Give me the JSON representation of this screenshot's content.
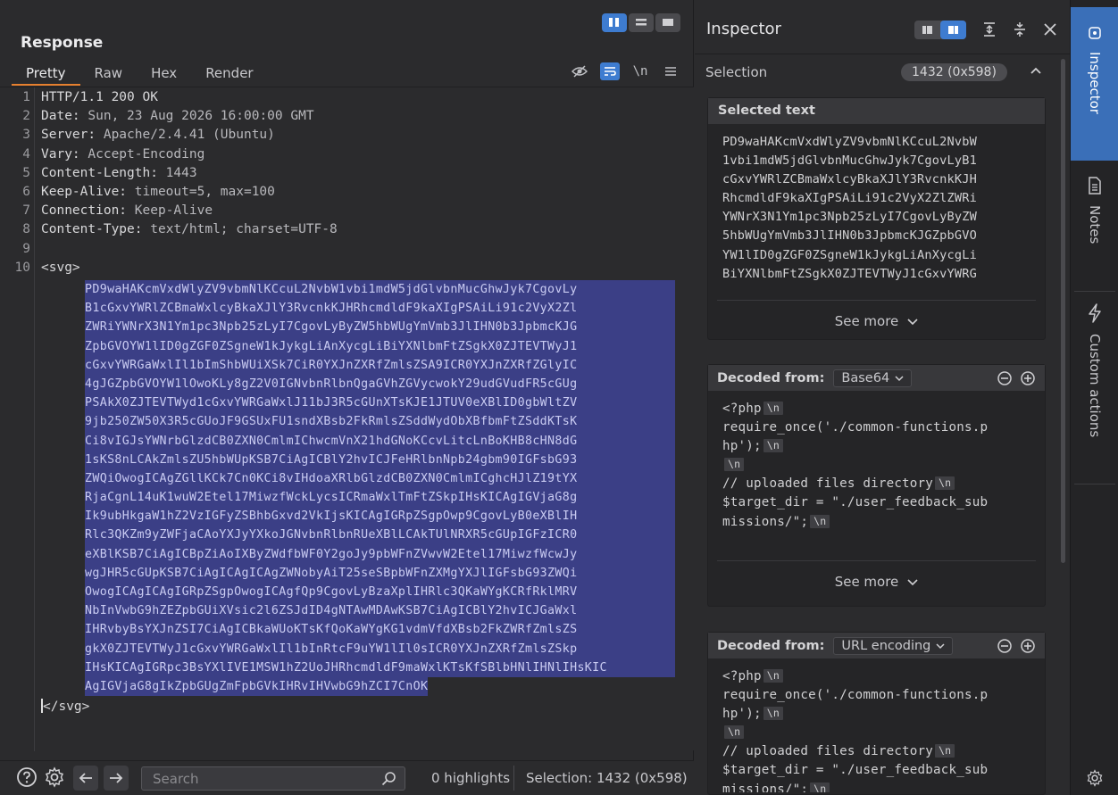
{
  "response": {
    "title": "Response",
    "tabs": [
      {
        "label": "Pretty",
        "active": true
      },
      {
        "label": "Raw"
      },
      {
        "label": "Hex"
      },
      {
        "label": "Render"
      }
    ],
    "newline_toggle": "\\n",
    "lines": [
      {
        "n": "1",
        "key": "HTTP/1.1 200 OK",
        "val": ""
      },
      {
        "n": "2",
        "key": "Date:",
        "val": " Sun, 23 Aug 2026 16:00:00 GMT"
      },
      {
        "n": "3",
        "key": "Server:",
        "val": " Apache/2.4.41 (Ubuntu)"
      },
      {
        "n": "4",
        "key": "Vary:",
        "val": " Accept-Encoding"
      },
      {
        "n": "5",
        "key": "Content-Length:",
        "val": " 1443"
      },
      {
        "n": "6",
        "key": "Keep-Alive:",
        "val": " timeout=5, max=100"
      },
      {
        "n": "7",
        "key": "Connection:",
        "val": " Keep-Alive"
      },
      {
        "n": "8",
        "key": "Content-Type:",
        "val": " text/html; charset=UTF-8"
      },
      {
        "n": "9",
        "key": "",
        "val": ""
      },
      {
        "n": "10",
        "key": "<svg>",
        "val": ""
      }
    ],
    "base64_lines": [
      "PD9waHAKcmVxdWlyZV9vbmNlKCcuL2NvbW1vbi1mdW5jdGlvbnMucGhwJyk7CgovLy",
      "B1cGxvYWRlZCBmaWxlcyBkaXJlY3RvcnkKJHRhcmdldF9kaXIgPSAiLi91c2VyX2Zl",
      "ZWRiYWNrX3N1Ym1pc3Npb25zLyI7CgovLyByZW5hbWUgYmVmb3JlIHN0b3JpbmcKJG",
      "ZpbGVOYW1lID0gZGF0ZSgneW1kJykgLiAnXycgLiBiYXNlbmFtZSgkX0ZJTEVTWyJ1",
      "cGxvYWRGaWxlIl1bImShbWUiXSk7CiR0YXJnZXRfZmlsZSA9ICR0YXJnZXRfZGlyIC",
      "4gJGZpbGVOYW1lOwoKLy8gZ2V0IGNvbnRlbnQgaGVhZGVycwokY29udGVudFR5cGUg",
      "PSAkX0ZJTEVTWyd1cGxvYWRGaWxlJ11bJ3R5cGUnXTsKJE1JTUV0eXBlID0gbWltZV",
      "9jb250ZW50X3R5cGUoJF9GSUxFU1sndXBsb2FkRmlsZSddWydObXBfbmFtZSddKTsK",
      "Ci8vIGJsYWNrbGlzdCB0ZXN0CmlmIChwcmVnX21hdGNoKCcvLitcLnBoKHB8cHN8dG",
      "1sKS8nLCAkZmlsZU5hbWUpKSB7CiAgICBlY2hvICJFeHRlbnNpb24gbm90IGFsbG93",
      "ZWQiOwogICAgZGllKCk7Cn0KCi8vIHdoaXRlbGlzdCB0ZXN0CmlmICghcHJlZ19tYX",
      "RjaCgnL14uK1wuW2Etel17MiwzfWckLycsICRmaWxlTmFtZSkpIHsKICAgIGVjaG8g",
      "Ik9ubHkgaW1hZ2VzIGFyZSBhbGxvd2VkIjsKICAgIGRpZSgpOwp9CgovLyB0eXBlIH",
      "Rlc3QKZm9yZWFjaCAoYXJyYXkoJGNvbnRlbnRUeXBlLCAkTUlNRXR5cGUpIGFzICR0",
      "eXBlKSB7CiAgICBpZiAoIXByZWdfbWF0Y2goJy9pbWFnZVwvW2Etel17MiwzfWcwJy",
      "wgJHR5cGUpKSB7CiAgICAgICAgZWNobyAiT25seSBpbWFnZXMgYXJlIGFsbG93ZWQi",
      "OwogICAgICAgIGRpZSgpOwogICAgfQp9CgovLyBzaXplIHRlc3QKaWYgKCRfRklMRV",
      "NbInVwbG9hZEZpbGUiXVsic2l6ZSJdID4gNTAwMDAwKSB7CiAgICBlY2hvICJGaWxl",
      "IHRvbyBsYXJnZSI7CiAgICBkaWUoKTsKfQoKaWYgKG1vdmVfdXBsb2FkZWRfZmlsZS",
      "gkX0ZJTEVTWyJ1cGxvYWRGaWxlIl1bInRtcF9uYW1lIl0sICR0YXJnZXRfZmlsZSkp",
      "IHsKICAgIGRpc3BsYXlIVE1MSW1hZ2UoJHRhcmdldF9maWxlKTsKfSBlbHNlIHNlIHsKIC",
      "AgIGVjaG8gIkZpbGUgZmFpbGVkIHRvIHVwbG9hZCI7CnOK"
    ],
    "close_tag_rest": "/svg>",
    "footer": {
      "search_placeholder": "Search",
      "highlights": "0 highlights",
      "selection": "Selection: 1432 (0x598)"
    }
  },
  "inspector": {
    "title": "Inspector",
    "selection_label": "Selection",
    "selection_badge": "1432 (0x598)",
    "selected_text": {
      "header": "Selected text",
      "lines": [
        "PD9waHAKcmVxdWlyZV9vbmNlKCcuL2NvbW",
        "1vbi1mdW5jdGlvbnMucGhwJyk7CgovLyB1",
        "cGxvYWRlZCBmaWxlcyBkaXJlY3RvcnkKJH",
        "RhcmdldF9kaXIgPSAiLi91c2VyX2ZlZWRi",
        "YWNrX3N1Ym1pc3Npb25zLyI7CgovLyByZW",
        "5hbWUgYmVmb3JlIHN0b3JpbmcKJGZpbGVO",
        "YW1lID0gZGF0ZSgneW1kJykgLiAnXycgLi",
        "BiYXNlbmFtZSgkX0ZJTEVTWyJ1cGxvYWRG"
      ],
      "see_more": "See more"
    },
    "decoded_base64": {
      "label": "Decoded from:",
      "encoding": "Base64",
      "lines": [
        {
          "text": "<?php",
          "nl": true
        },
        {
          "text": "require_once('./common-functions.p",
          "nl": false
        },
        {
          "text": "hp');",
          "nl": true
        },
        {
          "text": "",
          "nl": true
        },
        {
          "text": "// uploaded files directory",
          "nl": true
        },
        {
          "text": "$target_dir = \"./user_feedback_sub",
          "nl": false
        },
        {
          "text": "missions/\";",
          "nl": true
        }
      ],
      "see_more": "See more"
    },
    "decoded_url": {
      "label": "Decoded from:",
      "encoding": "URL encoding",
      "lines": [
        {
          "text": "<?php",
          "nl": true
        },
        {
          "text": "require_once('./common-functions.p",
          "nl": false
        },
        {
          "text": "hp');",
          "nl": true
        },
        {
          "text": "",
          "nl": true
        },
        {
          "text": "// uploaded files directory",
          "nl": true
        },
        {
          "text": "$target_dir = \"./user_feedback_sub",
          "nl": false
        },
        {
          "text": "missions/\";",
          "nl": true
        }
      ]
    },
    "nl_badge": "\\n"
  },
  "rail": {
    "tabs": [
      {
        "label": "Inspector",
        "active": true
      },
      {
        "label": "Notes"
      },
      {
        "label": "Custom actions"
      }
    ]
  },
  "colors": {
    "accent": "#3e7cd0",
    "tab_underline": "#e6802f",
    "selection_bg": "#3b3f86"
  }
}
